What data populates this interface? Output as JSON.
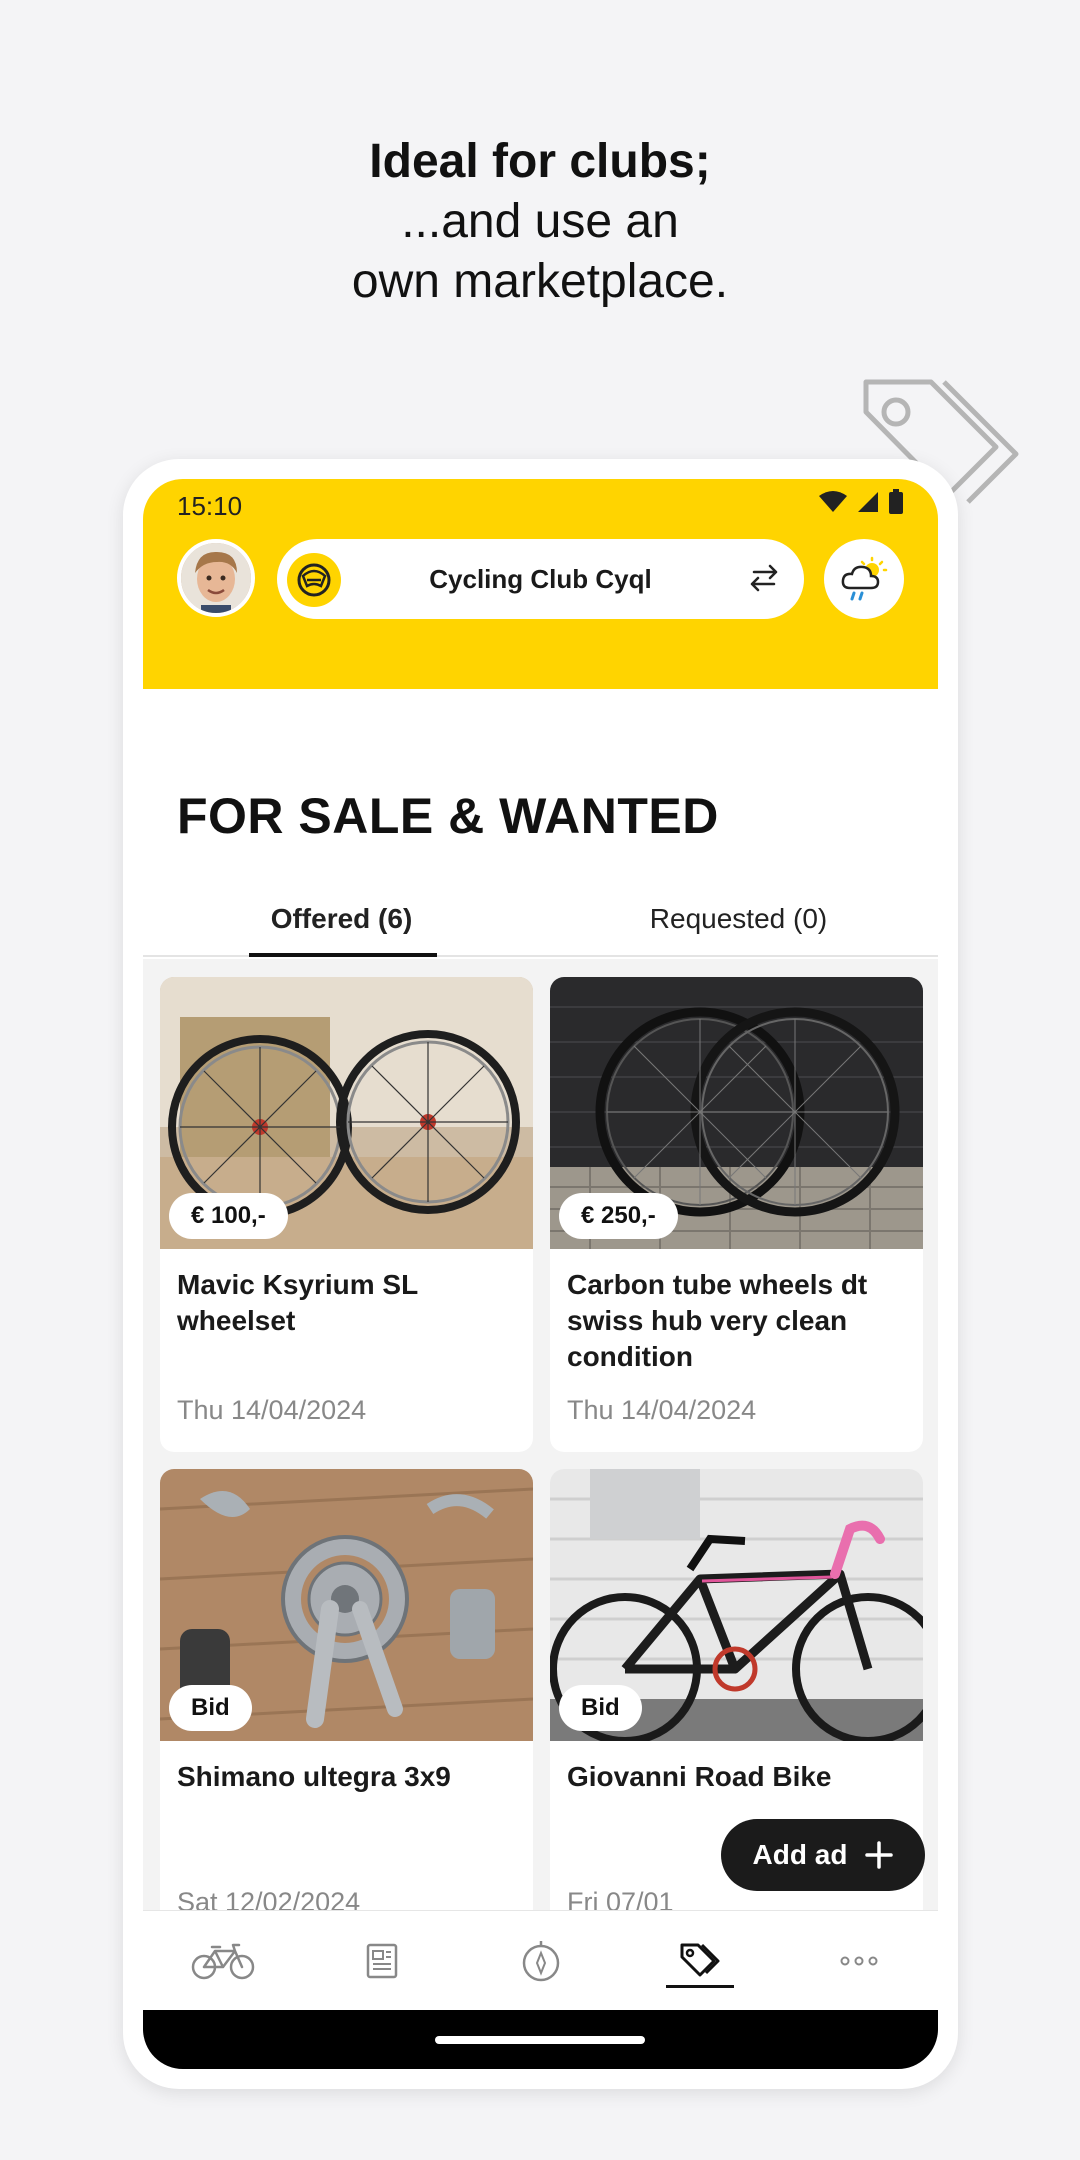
{
  "promo": {
    "line1": "Ideal for clubs;",
    "line2": "...and use an",
    "line3": "own marketplace."
  },
  "status_bar": {
    "time": "15:10"
  },
  "header": {
    "club_name": "Cycling Club Cyql"
  },
  "page": {
    "title": "FOR SALE & WANTED"
  },
  "tabs": [
    {
      "label": "Offered (6)",
      "active": true
    },
    {
      "label": "Requested (0)",
      "active": false
    }
  ],
  "listings": [
    {
      "price": "€ 100,-",
      "title": "Mavic Ksyrium SL wheelset",
      "date": "Thu  14/04/2024"
    },
    {
      "price": "€ 250,-",
      "title": "Carbon tube wheels dt swiss hub very clean condition",
      "date": "Thu  14/04/2024"
    },
    {
      "price": "Bid",
      "title": "Shimano ultegra 3x9",
      "date": "Sat  12/02/2024"
    },
    {
      "price": "Bid",
      "title": "Giovanni Road Bike",
      "date": "Fri  07/01"
    }
  ],
  "add_ad": {
    "label": "Add ad"
  },
  "bottom_nav": [
    {
      "icon": "bike-icon"
    },
    {
      "icon": "news-icon"
    },
    {
      "icon": "compass-icon"
    },
    {
      "icon": "tag-icon",
      "active": true
    },
    {
      "icon": "more-icon"
    }
  ],
  "colors": {
    "brand": "#ffd400",
    "dark": "#1b1b1b"
  }
}
